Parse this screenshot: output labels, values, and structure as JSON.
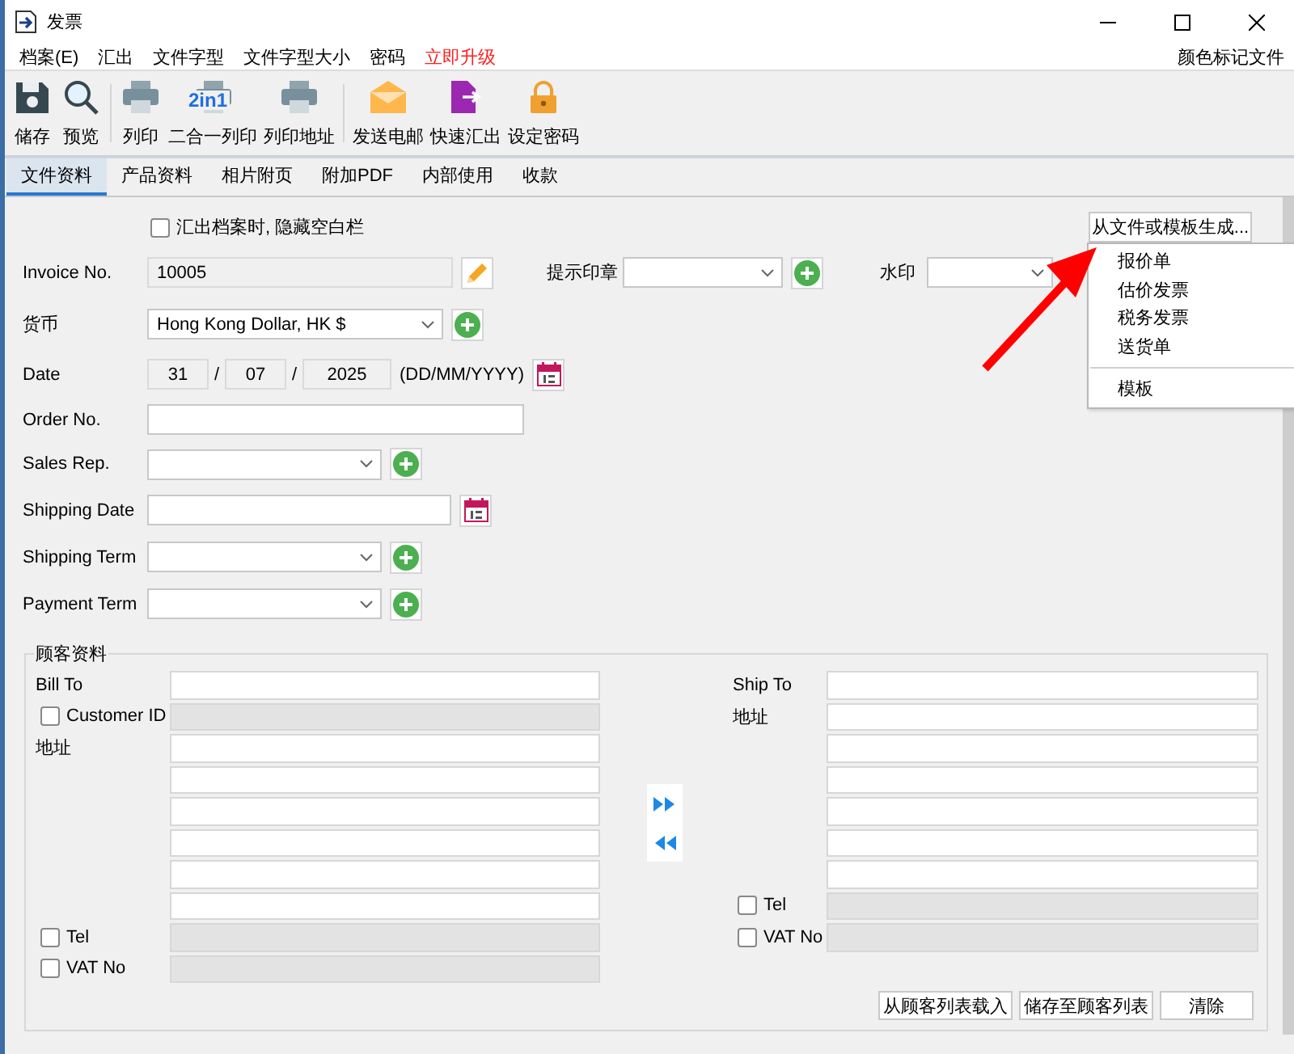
{
  "window": {
    "title": "发票"
  },
  "menu": {
    "items": [
      {
        "label": "档案(E)",
        "highlight": false
      },
      {
        "label": "汇出",
        "highlight": false
      },
      {
        "label": "文件字型",
        "highlight": false
      },
      {
        "label": "文件字型大小",
        "highlight": false
      },
      {
        "label": "密码",
        "highlight": false
      },
      {
        "label": "立即升级",
        "highlight": true
      }
    ],
    "right": "颜色标记文件"
  },
  "toolbar": {
    "groups": [
      [
        {
          "label": "储存",
          "kind": "save"
        },
        {
          "label": "预览",
          "kind": "preview"
        }
      ],
      [
        {
          "label": "列印",
          "kind": "print"
        },
        {
          "label": "二合一列印",
          "kind": "print",
          "badge": "2in1"
        },
        {
          "label": "列印地址",
          "kind": "print"
        }
      ],
      [
        {
          "label": "发送电邮",
          "kind": "mail"
        },
        {
          "label": "快速汇出",
          "kind": "export"
        },
        {
          "label": "设定密码",
          "kind": "lock"
        }
      ]
    ]
  },
  "tabs": [
    {
      "label": "文件资料",
      "selected": true
    },
    {
      "label": "产品资料",
      "selected": false
    },
    {
      "label": "相片附页",
      "selected": false
    },
    {
      "label": "附加PDF",
      "selected": false
    },
    {
      "label": "内部使用",
      "selected": false
    },
    {
      "label": "收款",
      "selected": false
    }
  ],
  "form": {
    "hide_blank": {
      "label": "汇出档案时, 隐藏空白栏",
      "checked": false
    },
    "generate_button": "从文件或模板生成...",
    "invoice_no": {
      "label": "Invoice No.",
      "value": "10005"
    },
    "stamp": {
      "label": "提示印章"
    },
    "watermark": {
      "label": "水印"
    },
    "currency": {
      "label": "货币",
      "value": "Hong Kong Dollar, HK $"
    },
    "date": {
      "label": "Date",
      "day": "31",
      "month": "07",
      "year": "2025",
      "separators": [
        "/",
        "/"
      ],
      "format": "(DD/MM/YYYY)"
    },
    "order_no": {
      "label": "Order No."
    },
    "sales_rep": {
      "label": "Sales Rep."
    },
    "shipping_date": {
      "label": "Shipping Date"
    },
    "shipping_term": {
      "label": "Shipping Term"
    },
    "payment_term": {
      "label": "Payment Term"
    }
  },
  "generate_menu": {
    "items": [
      "报价单",
      "估价发票",
      "税务发票",
      "送货单"
    ],
    "extra_items": [
      "模板"
    ]
  },
  "customer": {
    "title": "顾客资料",
    "bill_to": {
      "label": "Bill To"
    },
    "customer_id": {
      "label": "Customer ID",
      "checked": false
    },
    "bill_address_label": "地址",
    "bill_tel": {
      "label": "Tel",
      "checked": false
    },
    "bill_vat": {
      "label": "VAT No",
      "checked": false
    },
    "ship_to": {
      "label": "Ship To"
    },
    "ship_address_label": "地址",
    "ship_tel": {
      "label": "Tel",
      "checked": false
    },
    "ship_vat": {
      "label": "VAT No",
      "checked": false
    },
    "buttons": [
      "从顾客列表载入",
      "储存至顾客列表",
      "清除"
    ]
  }
}
